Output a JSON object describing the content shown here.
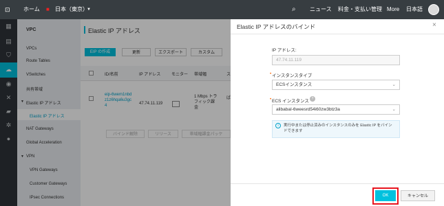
{
  "topbar": {
    "home": "ホーム",
    "region": "日本（東京）",
    "news": "ニュース",
    "billing": "料金・支払い管理",
    "more": "More",
    "lang": "日本語"
  },
  "sidebar": {
    "title": "VPC",
    "items": [
      "VPCs",
      "Route Tables",
      "VSwitches",
      "共有帯域",
      "Elastic IP アドレス",
      "Elastic IP アドレス",
      "NAT Gateways",
      "Global Acceleration",
      "VPN",
      "VPN Gateways",
      "Customer Gateways",
      "IPsec Connections"
    ]
  },
  "main": {
    "title": "Elastic IP アドレス",
    "buttons": [
      "EIP の作成",
      "更新",
      "エクスポート",
      "カスタム"
    ],
    "columns": [
      "ID/名前",
      "IP アドレス",
      "モニター",
      "帯域幅",
      "ス"
    ],
    "row": {
      "id": "eip-6wem1nbdz1z6hqa6u3gc4",
      "ip": "47.74.11.119",
      "bandwidth": "1 Mbps トラフィック課金",
      "status": "ば"
    },
    "bottom_buttons": [
      "バインド解除",
      "リリース",
      "帯域幅課金パッケ"
    ]
  },
  "dialog": {
    "title": "Elastic IP アドレスのバインド",
    "ip_label": "IP アドレス:",
    "ip_value": "47.74.11.119",
    "type_label": "インスタンスタイプ",
    "type_value": "ECSインスタンス",
    "ecs_label": "ECS インスタンス",
    "ecs_value": "alibabaI-6weesrd54i60zw3btz3a",
    "info": "実行中または停止済みのインスタンスのみを Elastic IP をバインドできます",
    "ok": "OK",
    "cancel": "キャンセル"
  },
  "colors": {
    "topbar": "#373d41",
    "accent": "#00c1de",
    "highlight": "#e8131d"
  }
}
